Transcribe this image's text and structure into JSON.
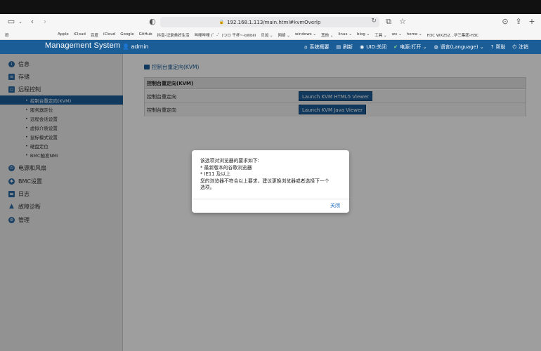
{
  "browser": {
    "url": "192.168.1.113/main.html#kvmOverlp",
    "bookmarks": [
      "Apple",
      "iCloud",
      "百度",
      "iCloud",
      "Google",
      "GitHub",
      "抖音-记录美好生活",
      "哔哩哔哩 (゜-゜)つロ 干杯~-bilibili",
      "贝加 ⌄",
      "网络 ⌄",
      "windows ⌄",
      "其他 ⌄",
      "linux ⌄",
      "blog ⌄",
      "工具 ⌄",
      "wx ⌄",
      "home ⌄",
      "H3C WX252...华三集团-H3C"
    ]
  },
  "header": {
    "title": "Management System",
    "user": "admin",
    "nav": [
      {
        "icon": "home-icon",
        "label": "系统概要"
      },
      {
        "icon": "refresh-icon",
        "label": "刷新"
      },
      {
        "icon": "uid-icon",
        "label": "UID:关闭"
      },
      {
        "icon": "power-icon",
        "label": "电源:打开 ⌄"
      },
      {
        "icon": "globe-icon",
        "label": "语言(Language) ⌄"
      },
      {
        "icon": "help-icon",
        "label": "帮助"
      },
      {
        "icon": "logout-icon",
        "label": "注销"
      }
    ]
  },
  "sidebar": {
    "items": [
      {
        "label": "信息"
      },
      {
        "label": "存储"
      },
      {
        "label": "远程控制"
      },
      {
        "label": "电源和风扇"
      },
      {
        "label": "BMC设置"
      },
      {
        "label": "日志"
      },
      {
        "label": "故障诊断"
      },
      {
        "label": "管理"
      }
    ],
    "subitems": [
      {
        "label": "控制台重定向(KVM)"
      },
      {
        "label": "服务器定位"
      },
      {
        "label": "远程会话设置"
      },
      {
        "label": "虚拟介质设置"
      },
      {
        "label": "鼠标模式设置"
      },
      {
        "label": "硬盘定位"
      },
      {
        "label": "BMC触发NMI"
      }
    ]
  },
  "main": {
    "page_title": "控制台重定向(KVM)",
    "panel_title": "控制台重定向(KVM)",
    "rows": [
      {
        "label": "控制台重定向",
        "button": "Launch KVM HTML5 Viewer"
      },
      {
        "label": "控制台重定向",
        "button": "Launch KVM Java Viewer"
      }
    ]
  },
  "modal": {
    "lines": [
      "该选项对浏览器的要求如下:",
      "* 最新版本的谷歌浏览器",
      "* IE11 及以上",
      "您的浏览器不符合以上要求，建议更换浏览器或者选择下一个",
      "选项。"
    ],
    "close_label": "关闭"
  }
}
